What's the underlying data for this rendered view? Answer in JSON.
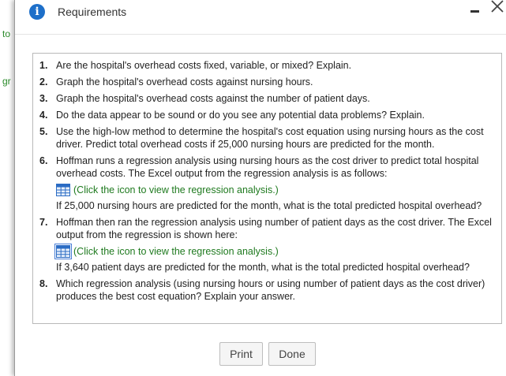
{
  "background": {
    "text_to": "to",
    "text_gr": "gr"
  },
  "dialog": {
    "icon_glyph": "i",
    "title": "Requirements"
  },
  "requirements": [
    {
      "num": "1.",
      "text": "Are the hospital's overhead costs fixed, variable, or mixed? Explain."
    },
    {
      "num": "2.",
      "text": "Graph the hospital's overhead costs against nursing hours."
    },
    {
      "num": "3.",
      "text": "Graph the hospital's overhead costs against the number of patient days."
    },
    {
      "num": "4.",
      "text": "Do the data appear to be sound or do you see any potential data problems? Explain."
    },
    {
      "num": "5.",
      "text": "Use the high-low method to determine the hospital's cost equation using nursing hours as the cost driver. Predict total overhead costs if 25,000 nursing hours are predicted for the month."
    },
    {
      "num": "6.",
      "text": "Hoffman runs a regression analysis using nursing hours as the cost driver to predict total hospital overhead costs. The Excel output from the regression analysis is as follows:",
      "link": "(Click the icon to view the regression analysis.)",
      "after": "If 25,000 nursing hours are predicted for the month, what is the total predicted hospital overhead?"
    },
    {
      "num": "7.",
      "text": "Hoffman then ran the regression analysis using number of patient days as the cost driver. The Excel output from the regression is shown here:",
      "link": "(Click the icon to view the regression analysis.)",
      "after": "If 3,640 patient days are predicted for the month, what is the total predicted hospital overhead?"
    },
    {
      "num": "8.",
      "text": "Which regression analysis (using nursing hours or using number of patient days as the cost driver) produces the best cost equation? Explain your answer."
    }
  ],
  "buttons": {
    "print": "Print",
    "done": "Done"
  },
  "colors": {
    "info_icon": "#1d6fc9",
    "link": "#1f7a1f",
    "table_icon": "#2b6cc4"
  },
  "icons": {
    "info": "info-icon",
    "minimize": "minimize-icon",
    "close": "close-icon",
    "table": "table-grid-icon"
  }
}
